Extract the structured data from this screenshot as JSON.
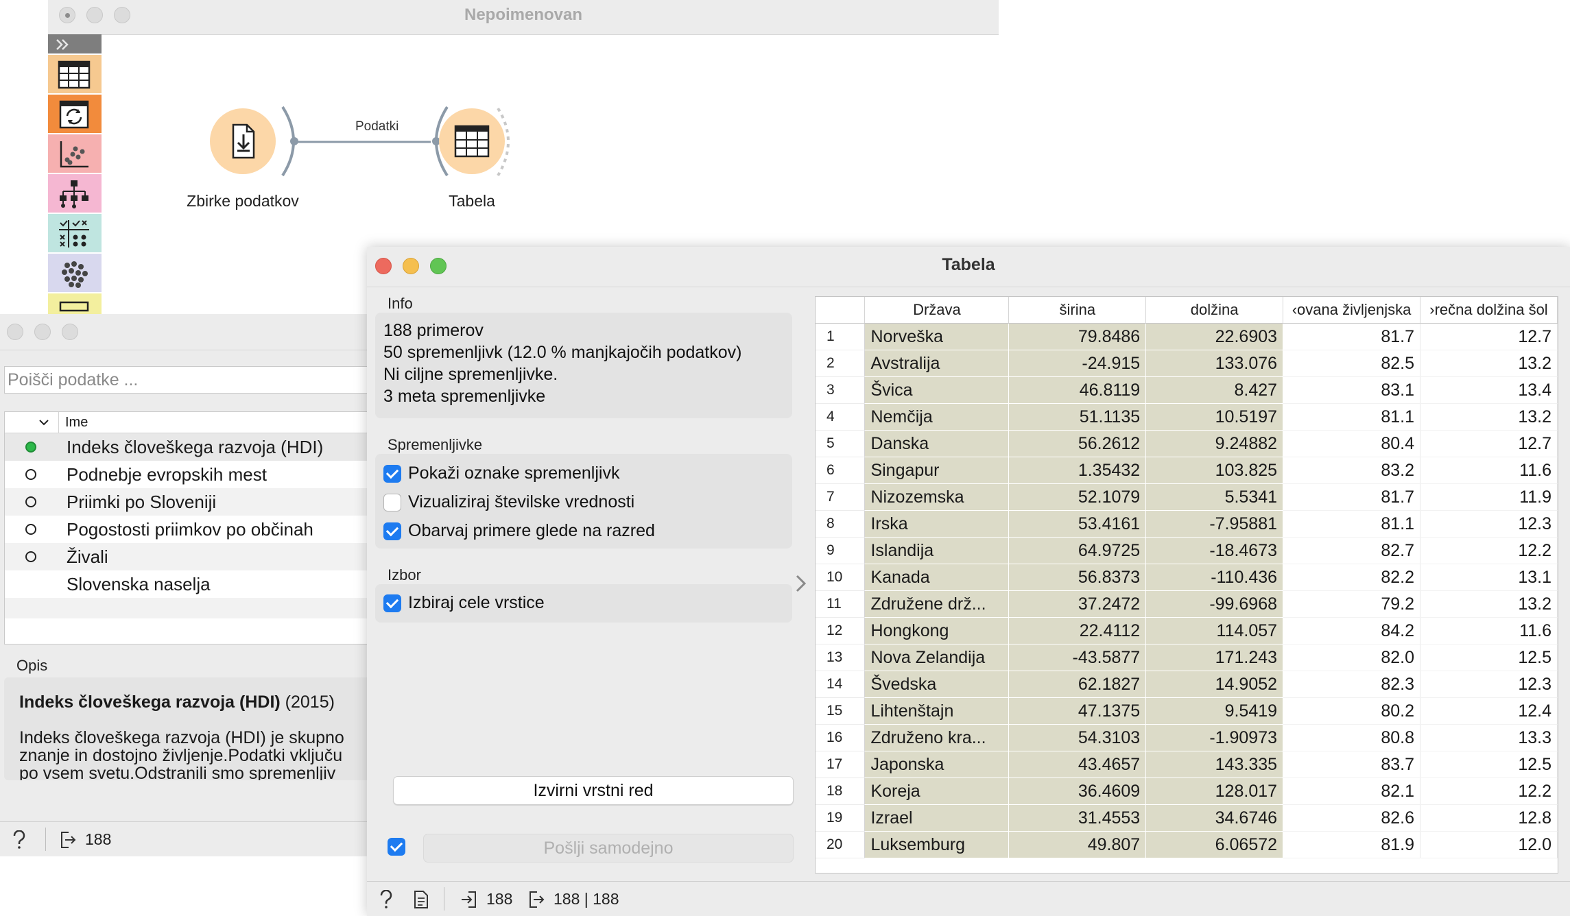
{
  "canvas_window": {
    "title": "Nepoimenovan",
    "nodes": [
      {
        "label": "Zbirke podatkov",
        "icon": "file-import-icon"
      },
      {
        "label": "Tabela",
        "icon": "table-icon"
      }
    ],
    "link_label": "Podatki",
    "toolbox": [
      {
        "icon": "expand-icon",
        "color": "#7e7e7e"
      },
      {
        "icon": "table-icon",
        "color": "#f6c990"
      },
      {
        "icon": "transform-icon",
        "color": "#f28b3c"
      },
      {
        "icon": "scatter-icon",
        "color": "#f6b0b0"
      },
      {
        "icon": "tree-icon",
        "color": "#f5b7d2"
      },
      {
        "icon": "evaluate-icon",
        "color": "#bfe5e0"
      },
      {
        "icon": "cluster-icon",
        "color": "#d8d8ee"
      },
      {
        "icon": "more-icon",
        "color": "#f3ef9e"
      }
    ]
  },
  "datasets_window": {
    "search_placeholder": "Poišči podatke ...",
    "column_header": "Ime",
    "items": [
      {
        "name": "Indeks človeškega razvoja (HDI)",
        "state": "loaded"
      },
      {
        "name": "Podnebje evropskih mest",
        "state": "available"
      },
      {
        "name": "Priimki po Sloveniji",
        "state": "available"
      },
      {
        "name": "Pogostosti priimkov po občinah",
        "state": "available"
      },
      {
        "name": "Živali",
        "state": "available"
      },
      {
        "name": "Slovenska naselja",
        "state": "none"
      }
    ],
    "description_label": "Opis",
    "description_title": "Indeks človeškega razvoja (HDI)",
    "description_year": "(2015)",
    "description_lines": [
      "Indeks človeškega razvoja (HDI) je skupno",
      "znanje in dostojno življenje.Podatki vključu",
      "po vsem svetu.Odstranili smo spremenljiv"
    ],
    "status_count": "188"
  },
  "table_window": {
    "title": "Tabela",
    "info_label": "Info",
    "info_lines": [
      "188 primerov",
      "50  spremenljivk (12.0 % manjkajočih podatkov)",
      "Ni ciljne spremenljivke.",
      "3 meta spremenljivke"
    ],
    "variables_label": "Spremenljivke",
    "options": [
      {
        "label": "Pokaži oznake spremenljivk",
        "checked": true
      },
      {
        "label": "Vizualiziraj številske vrednosti",
        "checked": false
      },
      {
        "label": "Obarvaj primere glede na razred",
        "checked": true
      }
    ],
    "selection_label": "Izbor",
    "selection_option": {
      "label": "Izbiraj cele vrstice",
      "checked": true
    },
    "restore_button": "Izvirni vrstni red",
    "send_button": "Pošlji samodejno",
    "auto_send_checked": true,
    "columns": [
      "Država",
      "širina",
      "dolžina",
      "‹ovana življenjska",
      "›rečna dolžina šol"
    ],
    "rows": [
      [
        "1",
        "Norveška",
        "79.8486",
        "22.6903",
        "81.7",
        "12.7"
      ],
      [
        "2",
        "Avstralija",
        "-24.915",
        "133.076",
        "82.5",
        "13.2"
      ],
      [
        "3",
        "Švica",
        "46.8119",
        "8.427",
        "83.1",
        "13.4"
      ],
      [
        "4",
        "Nemčija",
        "51.1135",
        "10.5197",
        "81.1",
        "13.2"
      ],
      [
        "5",
        "Danska",
        "56.2612",
        "9.24882",
        "80.4",
        "12.7"
      ],
      [
        "6",
        "Singapur",
        "1.35432",
        "103.825",
        "83.2",
        "11.6"
      ],
      [
        "7",
        "Nizozemska",
        "52.1079",
        "5.5341",
        "81.7",
        "11.9"
      ],
      [
        "8",
        "Irska",
        "53.4161",
        "-7.95881",
        "81.1",
        "12.3"
      ],
      [
        "9",
        "Islandija",
        "64.9725",
        "-18.4673",
        "82.7",
        "12.2"
      ],
      [
        "10",
        "Kanada",
        "56.8373",
        "-110.436",
        "82.2",
        "13.1"
      ],
      [
        "11",
        "Združene drž...",
        "37.2472",
        "-99.6968",
        "79.2",
        "13.2"
      ],
      [
        "12",
        "Hongkong",
        "22.4112",
        "114.057",
        "84.2",
        "11.6"
      ],
      [
        "13",
        "Nova Zelandija",
        "-43.5877",
        "171.243",
        "82.0",
        "12.5"
      ],
      [
        "14",
        "Švedska",
        "62.1827",
        "14.9052",
        "82.3",
        "12.3"
      ],
      [
        "15",
        "Lihtenštajn",
        "47.1375",
        "9.5419",
        "80.2",
        "12.4"
      ],
      [
        "16",
        "Združeno kra...",
        "54.3103",
        "-1.90973",
        "80.8",
        "13.3"
      ],
      [
        "17",
        "Japonska",
        "43.4657",
        "143.335",
        "83.7",
        "12.5"
      ],
      [
        "18",
        "Koreja",
        "36.4609",
        "128.017",
        "82.1",
        "12.2"
      ],
      [
        "19",
        "Izrael",
        "31.4553",
        "34.6746",
        "82.6",
        "12.8"
      ],
      [
        "20",
        "Luksemburg",
        "49.807",
        "6.06572",
        "81.9",
        "12.0"
      ]
    ],
    "status_input": "188",
    "status_output": "188 | 188"
  }
}
